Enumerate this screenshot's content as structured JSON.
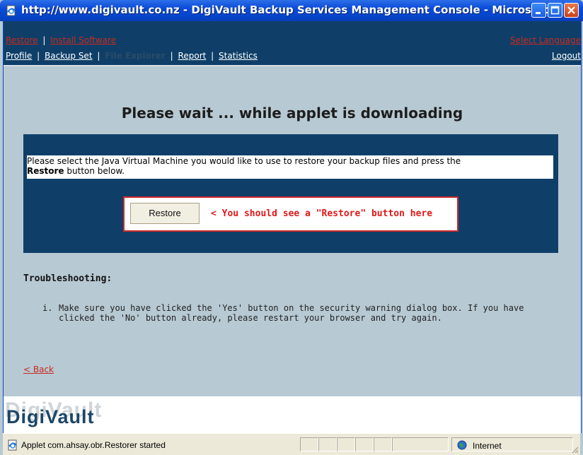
{
  "window": {
    "title": "http://www.digivault.co.nz - DigiVault Backup Services Management Console - Microsoft..."
  },
  "nav": {
    "row1_links": [
      "Restore",
      "Install Software"
    ],
    "row1_sep": "|",
    "language_link": "Select Language",
    "row2_links": [
      "Profile",
      "Backup Set",
      "File Explorer",
      "Report",
      "Statistics"
    ],
    "current_item": "File Explorer",
    "logout_link": "Logout"
  },
  "main": {
    "heading": "Please wait ... while applet is downloading",
    "instruction_before": "Please select the Java Virtual Machine you would like to use to restore your backup files and press the",
    "instruction_bold": "Restore",
    "instruction_after": "button below.",
    "restore_button": "Restore",
    "restore_note": "< You should see a \"Restore\" button here",
    "troubleshooting_title": "Troubleshooting:",
    "troubleshooting_items": [
      {
        "number": "i.",
        "text": "Make sure you have clicked the 'Yes' button on the security warning dialog box. If you have clicked the 'No' button already, please restart your browser and try again."
      }
    ],
    "back_link": "< Back"
  },
  "footer": {
    "logo_text": "DigiVault"
  },
  "status_bar": {
    "message": "Applet com.ahsay.obr.Restorer started",
    "zone": "Internet"
  },
  "colors": {
    "nav_bg": "#0f3f68",
    "page_bg": "#b7c9d3",
    "link_red": "#c72b1e",
    "alert_red": "#e21818",
    "title_bar": "#0545c9"
  },
  "icons": {
    "app": "ie-page-icon",
    "minimize": "minimize-icon",
    "maximize": "maximize-icon",
    "close": "close-icon",
    "zone": "globe-icon",
    "status": "ie-page-icon"
  }
}
